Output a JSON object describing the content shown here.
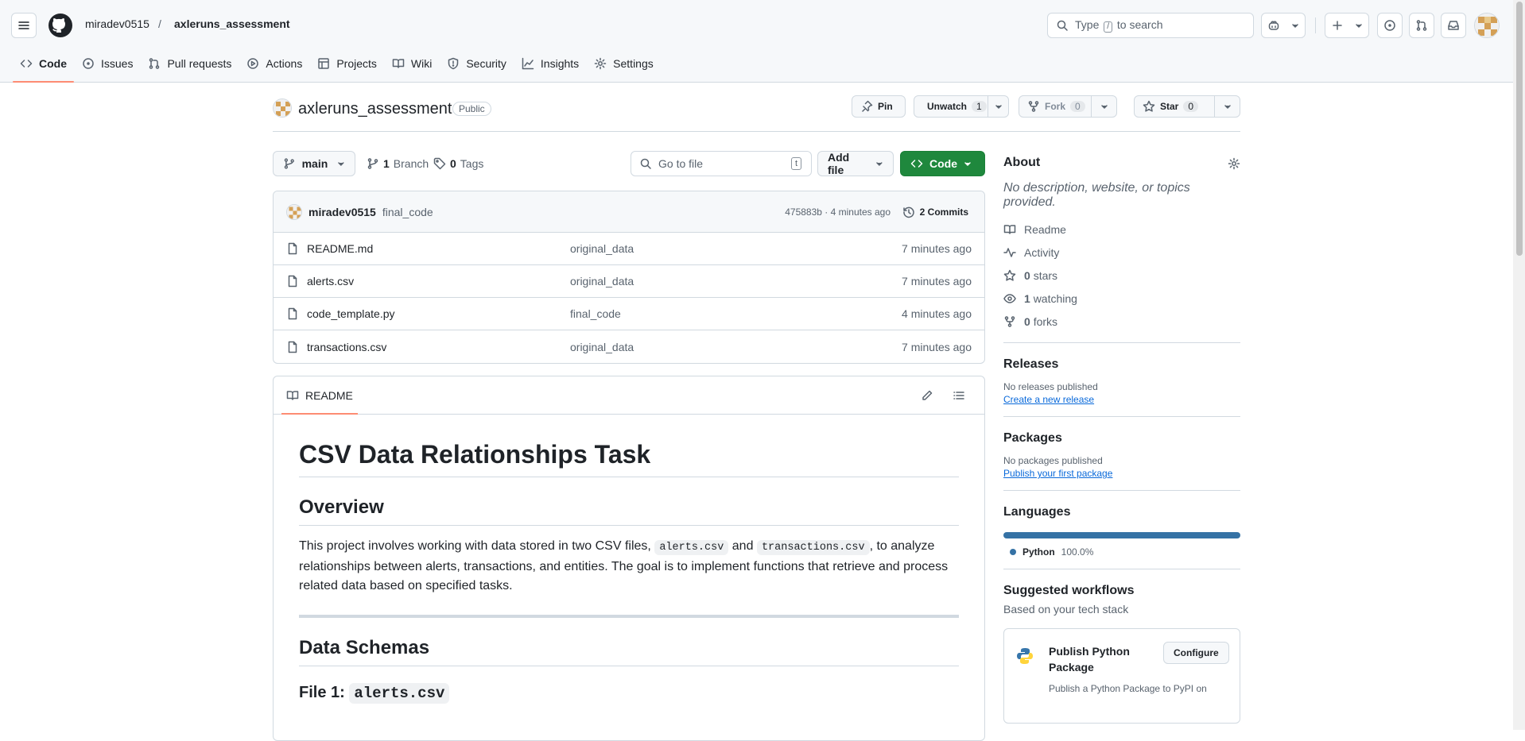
{
  "header": {
    "owner": "miradev0515",
    "separator": "/",
    "repo": "axleruns_assessment",
    "search_placeholder_before": "Type",
    "search_key": "/",
    "search_placeholder_after": "to search"
  },
  "tabs": [
    {
      "label": "Code",
      "icon": "code-icon"
    },
    {
      "label": "Issues",
      "icon": "issue-icon"
    },
    {
      "label": "Pull requests",
      "icon": "pull-request-icon"
    },
    {
      "label": "Actions",
      "icon": "play-icon"
    },
    {
      "label": "Projects",
      "icon": "table-icon"
    },
    {
      "label": "Wiki",
      "icon": "book-icon"
    },
    {
      "label": "Security",
      "icon": "shield-icon"
    },
    {
      "label": "Insights",
      "icon": "graph-icon"
    },
    {
      "label": "Settings",
      "icon": "gear-icon"
    }
  ],
  "repo_header": {
    "name": "axleruns_assessment",
    "visibility": "Public",
    "pin": "Pin",
    "unwatch": "Unwatch",
    "watch_count": "1",
    "fork": "Fork",
    "fork_count": "0",
    "star": "Star",
    "star_count": "0"
  },
  "branchbar": {
    "branch": "main",
    "branches_count": "1",
    "branches_label": "Branch",
    "tags_count": "0",
    "tags_label": "Tags",
    "goto_placeholder": "Go to file",
    "goto_key": "t",
    "add_file": "Add file",
    "code": "Code"
  },
  "commit": {
    "author": "miradev0515",
    "message": "final_code",
    "hash_time": "475883b · 4 minutes ago",
    "commits_label": "2 Commits"
  },
  "files": [
    {
      "name": "README.md",
      "message": "original_data",
      "time": "7 minutes ago"
    },
    {
      "name": "alerts.csv",
      "message": "original_data",
      "time": "7 minutes ago"
    },
    {
      "name": "code_template.py",
      "message": "final_code",
      "time": "4 minutes ago"
    },
    {
      "name": "transactions.csv",
      "message": "original_data",
      "time": "7 minutes ago"
    }
  ],
  "readme": {
    "tab": "README",
    "h1": "CSV Data Relationships Task",
    "overview_h": "Overview",
    "p1_a": "This project involves working with data stored in two CSV files,",
    "p1_code1": "alerts.csv",
    "p1_and": "and",
    "p1_code2": "transactions.csv",
    "p1_b": ", to analyze relationships between alerts, transactions, and entities. The goal is to implement functions that retrieve and process related data based on specified tasks.",
    "schemas_h": "Data Schemas",
    "file1_h": "File 1:",
    "file1_code": "alerts.csv"
  },
  "about": {
    "title": "About",
    "description": "No description, website, or topics provided.",
    "readme": "Readme",
    "activity": "Activity",
    "stars_n": "0",
    "stars": "stars",
    "watching_n": "1",
    "watching": "watching",
    "forks_n": "0",
    "forks": "forks"
  },
  "releases": {
    "title": "Releases",
    "none": "No releases published",
    "link": "Create a new release"
  },
  "packages": {
    "title": "Packages",
    "none": "No packages published",
    "link": "Publish your first package"
  },
  "languages": {
    "title": "Languages",
    "name": "Python",
    "percent": "100.0%",
    "percent_value": 100,
    "color": "#3572A5"
  },
  "workflows": {
    "title": "Suggested workflows",
    "subtitle": "Based on your tech stack",
    "card_title": "Publish Python Package",
    "configure": "Configure",
    "card_desc": "Publish a Python Package to PyPI on"
  },
  "colors": {
    "accent": "#fd8c73",
    "code_button": "#1f883d",
    "link": "#0969da"
  }
}
